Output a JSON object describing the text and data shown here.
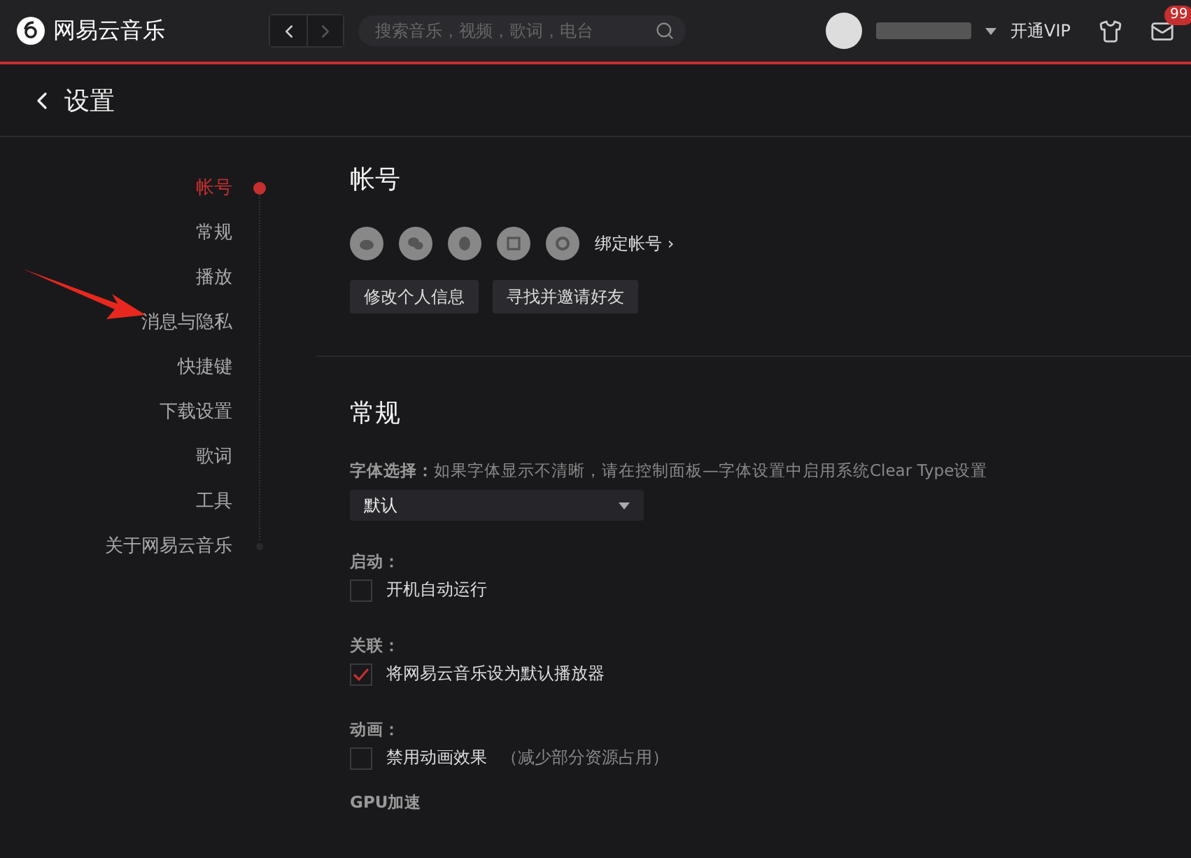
{
  "app": {
    "name": "网易云音乐"
  },
  "search": {
    "placeholder": "搜索音乐，视频，歌词，电台"
  },
  "top_actions": {
    "vip": "开通VIP",
    "mail_badge": "99"
  },
  "page": {
    "back_title": "设置"
  },
  "nav": [
    {
      "label": "帐号",
      "selected": true
    },
    {
      "label": "常规",
      "selected": false
    },
    {
      "label": "播放",
      "selected": false
    },
    {
      "label": "消息与隐私",
      "selected": false
    },
    {
      "label": "快捷键",
      "selected": false
    },
    {
      "label": "下载设置",
      "selected": false
    },
    {
      "label": "歌词",
      "selected": false
    },
    {
      "label": "工具",
      "selected": false
    },
    {
      "label": "关于网易云音乐",
      "selected": false
    }
  ],
  "account": {
    "title": "帐号",
    "bind_link": "绑定帐号 ›",
    "buttons": [
      "修改个人信息",
      "寻找并邀请好友"
    ]
  },
  "general": {
    "title": "常规",
    "font_label": "字体选择：",
    "font_hint": "如果字体显示不清晰，请在控制面板—字体设置中启用系统Clear Type设置",
    "font_value": "默认",
    "groups": [
      {
        "label": "启动：",
        "option": "开机自动运行",
        "checked": false
      },
      {
        "label": "关联：",
        "option": "将网易云音乐设为默认播放器",
        "checked": true
      },
      {
        "label": "动画：",
        "option": "禁用动画效果",
        "note": "（减少部分资源占用）",
        "checked": false
      }
    ],
    "next_label": "GPU加速"
  }
}
